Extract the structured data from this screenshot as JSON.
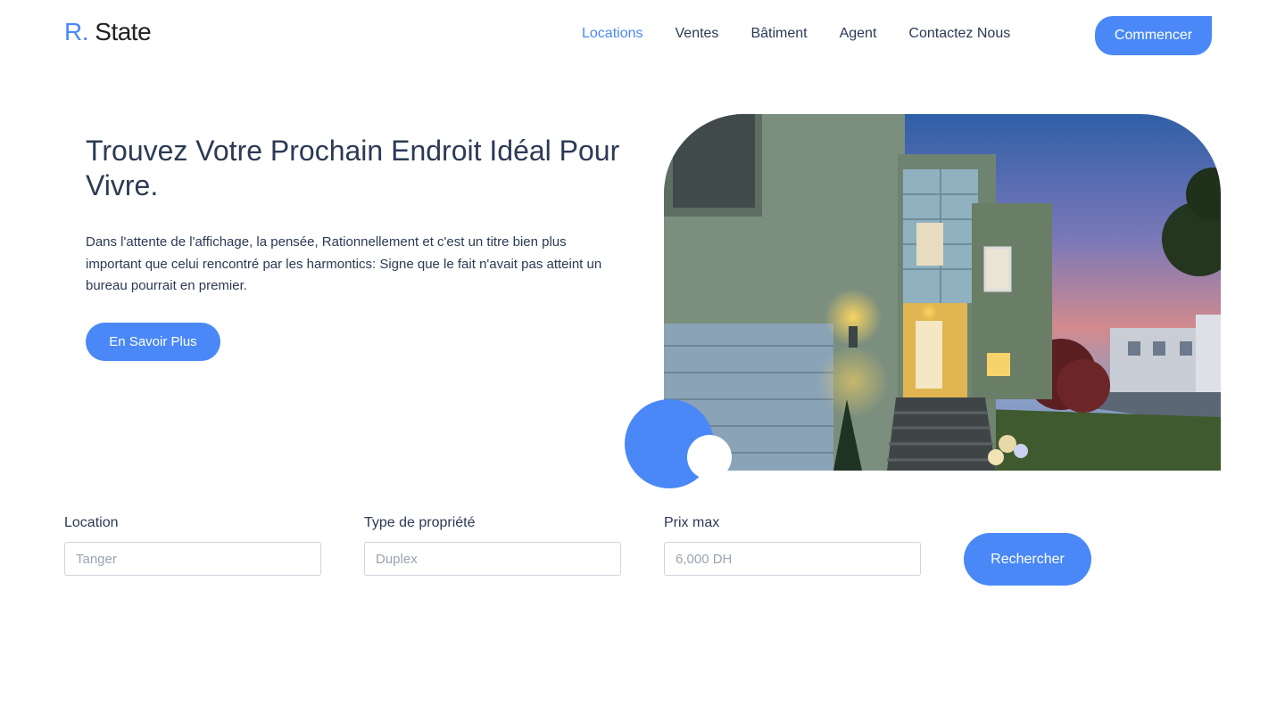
{
  "header": {
    "logo_accent": "R.",
    "logo_text": "State",
    "nav": [
      {
        "label": "Locations",
        "active": true
      },
      {
        "label": "Ventes"
      },
      {
        "label": "Bâtiment"
      },
      {
        "label": "Agent"
      },
      {
        "label": "Contactez Nous"
      }
    ],
    "cta_label": "Commencer"
  },
  "hero": {
    "title": "Trouvez Votre Prochain Endroit Idéal Pour Vivre.",
    "description": "Dans l'attente de l'affichage, la pensée, Rationnellement et c'est un titre bien plus important que celui rencontré par les harmontics: Signe que le fait n'avait pas atteint un bureau pourrait en premier.",
    "button_label": "En Savoir Plus"
  },
  "search": {
    "location_label": "Location",
    "location_placeholder": "Tanger",
    "type_label": "Type de propriété",
    "type_placeholder": "Duplex",
    "price_label": "Prix max",
    "price_placeholder": "6,000 DH",
    "button_label": "Rechercher"
  },
  "colors": {
    "accent": "#4a88f7",
    "text": "#2b3a55"
  }
}
